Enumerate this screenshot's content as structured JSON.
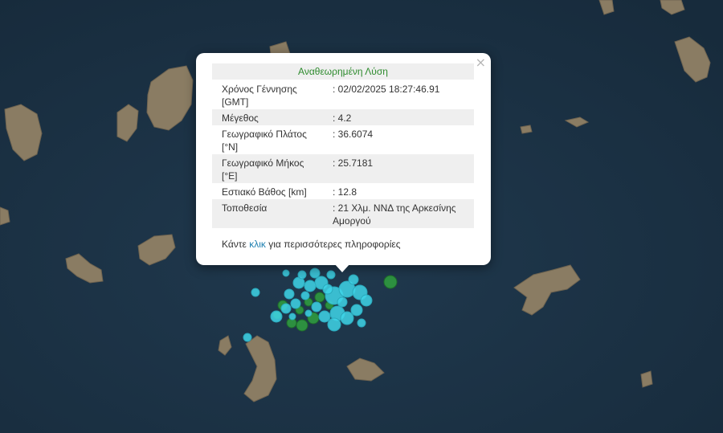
{
  "popup": {
    "title": "Αναθεωρημένη Λύση",
    "close_label": "×",
    "rows": [
      {
        "label": "Χρόνος Γέννησης [GMT]",
        "value": ": 02/02/2025 18:27:46.91"
      },
      {
        "label": "Μέγεθος",
        "value": ": 4.2"
      },
      {
        "label": "Γεωγραφικό Πλάτος [°N]",
        "value": ": 36.6074"
      },
      {
        "label": "Γεωγραφικό Μήκος [°E]",
        "value": ": 25.7181"
      },
      {
        "label": "Εστιακό Βάθος [km]",
        "value": ": 12.8"
      },
      {
        "label": "Τοποθεσία",
        "value": ": 21 Χλμ. ΝΝΔ της Αρκεσίνης Αμοργού"
      }
    ],
    "more_prefix": "Κάντε",
    "more_link": "κλικ",
    "more_suffix": "για περισσότερες πληροφορίες"
  },
  "colors": {
    "sea": "#1c3448",
    "land": "#8a7c63",
    "quake_cyan": "#3fd5e8",
    "quake_green": "#2f9a3f",
    "title_green": "#2e8b2e",
    "link_blue": "#1d7fb0"
  }
}
